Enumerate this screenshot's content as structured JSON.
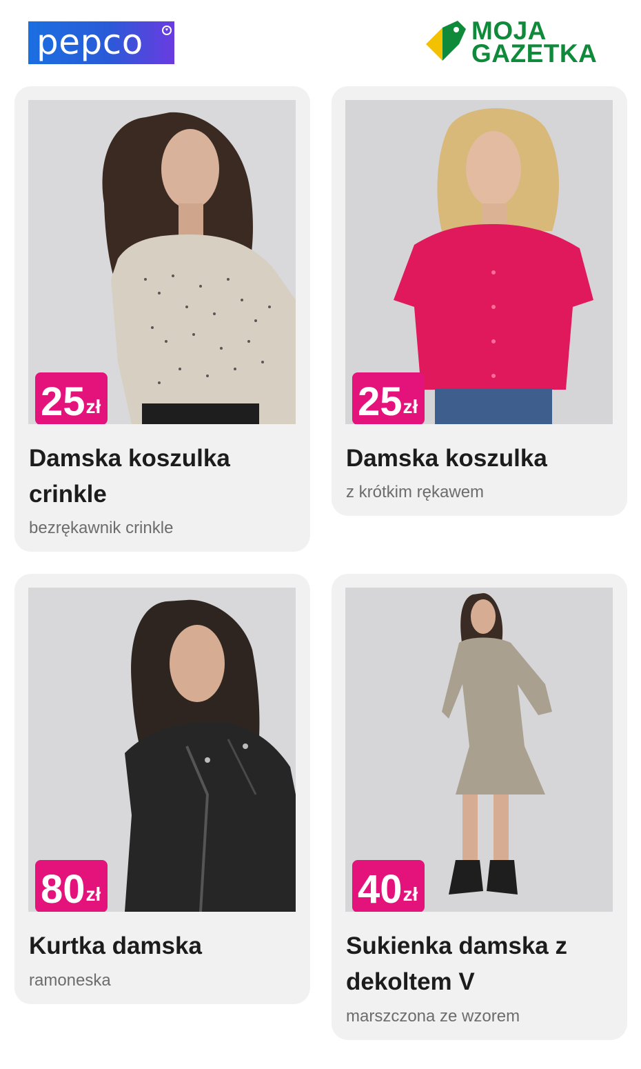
{
  "header": {
    "brand": "pepco",
    "partner_line1": "MOJA",
    "partner_line2": "GAZETKA"
  },
  "colors": {
    "price_badge": "#e3137b",
    "partner_green": "#0f8a3a",
    "pepco_blue": "#1b6fe0",
    "card_bg": "#f1f1f2"
  },
  "products": [
    {
      "price": "25",
      "currency": "zł",
      "title": "Damska koszulka crinkle",
      "subtitle": "bezrękawnik crinkle",
      "image": "woman-polka-dot-sleeveless-top-photo"
    },
    {
      "price": "25",
      "currency": "zł",
      "title": "Damska koszulka",
      "subtitle": "z krótkim rękawem",
      "image": "woman-pink-short-sleeve-shirt-photo"
    },
    {
      "price": "80",
      "currency": "zł",
      "title": "Kurtka damska",
      "subtitle": "ramoneska",
      "image": "woman-black-leather-jacket-photo"
    },
    {
      "price": "40",
      "currency": "zł",
      "title": "Sukienka damska z dekoltem V",
      "subtitle": "marszczona ze wzorem",
      "image": "woman-patterned-v-neck-dress-photo"
    }
  ]
}
